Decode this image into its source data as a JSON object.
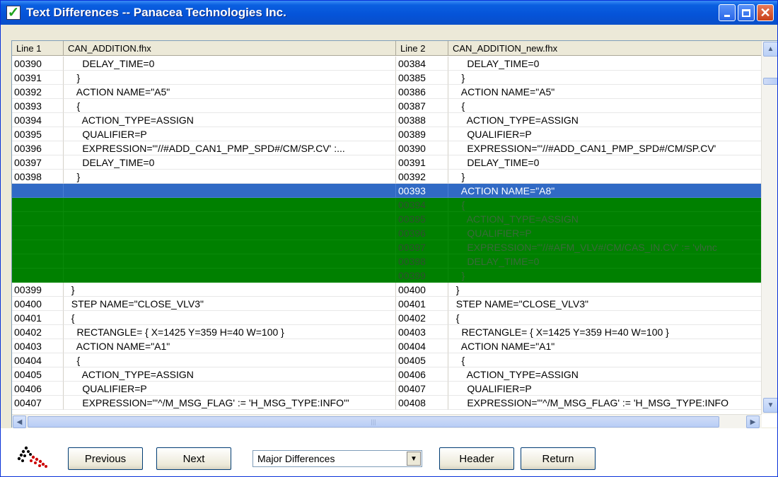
{
  "window": {
    "title": "Text Differences -- Panacea Technologies Inc.",
    "icon": "check-mark-icon"
  },
  "grid": {
    "headers": {
      "line1": "Line 1",
      "file1": "CAN_ADDITION.fhx",
      "line2": "Line 2",
      "file2": "CAN_ADDITION_new.fhx"
    },
    "rows": [
      {
        "l1": "00390",
        "t1": "      DELAY_TIME=0",
        "l2": "00384",
        "t2": "      DELAY_TIME=0",
        "state": "normal"
      },
      {
        "l1": "00391",
        "t1": "    }",
        "l2": "00385",
        "t2": "    }",
        "state": "normal"
      },
      {
        "l1": "00392",
        "t1": "    ACTION NAME=\"A5\"",
        "l2": "00386",
        "t2": "    ACTION NAME=\"A5\"",
        "state": "normal"
      },
      {
        "l1": "00393",
        "t1": "    {",
        "l2": "00387",
        "t2": "    {",
        "state": "normal"
      },
      {
        "l1": "00394",
        "t1": "      ACTION_TYPE=ASSIGN",
        "l2": "00388",
        "t2": "      ACTION_TYPE=ASSIGN",
        "state": "normal"
      },
      {
        "l1": "00395",
        "t1": "      QUALIFIER=P",
        "l2": "00389",
        "t2": "      QUALIFIER=P",
        "state": "normal"
      },
      {
        "l1": "00396",
        "t1": "      EXPRESSION=\"'//#ADD_CAN1_PMP_SPD#/CM/SP.CV' :...",
        "l2": "00390",
        "t2": "      EXPRESSION=\"'//#ADD_CAN1_PMP_SPD#/CM/SP.CV'",
        "state": "normal"
      },
      {
        "l1": "00397",
        "t1": "      DELAY_TIME=0",
        "l2": "00391",
        "t2": "      DELAY_TIME=0",
        "state": "normal"
      },
      {
        "l1": "00398",
        "t1": "    }",
        "l2": "00392",
        "t2": "    }",
        "state": "normal"
      },
      {
        "l1": "",
        "t1": "",
        "l2": "00393",
        "t2": "    ACTION NAME=\"A8\"",
        "state": "sel"
      },
      {
        "l1": "",
        "t1": "",
        "l2": "00394",
        "t2": "    {",
        "state": "diff"
      },
      {
        "l1": "",
        "t1": "",
        "l2": "00395",
        "t2": "      ACTION_TYPE=ASSIGN",
        "state": "diff"
      },
      {
        "l1": "",
        "t1": "",
        "l2": "00396",
        "t2": "      QUALIFIER=P",
        "state": "diff"
      },
      {
        "l1": "",
        "t1": "",
        "l2": "00397",
        "t2": "      EXPRESSION=\"'//#AFM_VLV#/CM/CAS_IN.CV' := 'vlvnc",
        "state": "diff"
      },
      {
        "l1": "",
        "t1": "",
        "l2": "00398",
        "t2": "      DELAY_TIME=0",
        "state": "diff"
      },
      {
        "l1": "",
        "t1": "",
        "l2": "00399",
        "t2": "    }",
        "state": "diff"
      },
      {
        "l1": "00399",
        "t1": "  }",
        "l2": "00400",
        "t2": "  }",
        "state": "normal"
      },
      {
        "l1": "00400",
        "t1": "  STEP NAME=\"CLOSE_VLV3\"",
        "l2": "00401",
        "t2": "  STEP NAME=\"CLOSE_VLV3\"",
        "state": "normal"
      },
      {
        "l1": "00401",
        "t1": "  {",
        "l2": "00402",
        "t2": "  {",
        "state": "normal"
      },
      {
        "l1": "00402",
        "t1": "    RECTANGLE= { X=1425 Y=359 H=40 W=100 }",
        "l2": "00403",
        "t2": "    RECTANGLE= { X=1425 Y=359 H=40 W=100 }",
        "state": "normal"
      },
      {
        "l1": "00403",
        "t1": "    ACTION NAME=\"A1\"",
        "l2": "00404",
        "t2": "    ACTION NAME=\"A1\"",
        "state": "normal"
      },
      {
        "l1": "00404",
        "t1": "    {",
        "l2": "00405",
        "t2": "    {",
        "state": "normal"
      },
      {
        "l1": "00405",
        "t1": "      ACTION_TYPE=ASSIGN",
        "l2": "00406",
        "t2": "      ACTION_TYPE=ASSIGN",
        "state": "normal"
      },
      {
        "l1": "00406",
        "t1": "      QUALIFIER=P",
        "l2": "00407",
        "t2": "      QUALIFIER=P",
        "state": "normal"
      },
      {
        "l1": "00407",
        "t1": "      EXPRESSION=\"'^/M_MSG_FLAG' := 'H_MSG_TYPE:INFO'\"",
        "l2": "00408",
        "t2": "      EXPRESSION=\"'^/M_MSG_FLAG' := 'H_MSG_TYPE:INFO",
        "state": "normal"
      }
    ]
  },
  "toolbar": {
    "previous_label": "Previous",
    "next_label": "Next",
    "filter_value": "Major Differences",
    "header_label": "Header",
    "return_label": "Return"
  },
  "colors": {
    "selected_row": "#316ac5",
    "difference_row": "#008000",
    "titlebar": "#0553d8"
  }
}
